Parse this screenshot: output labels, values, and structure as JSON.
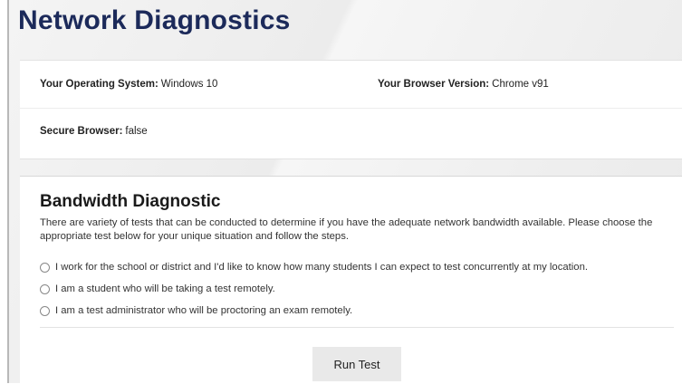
{
  "header": {
    "title": "Network Diagnostics"
  },
  "system_info": {
    "os_label": "Your Operating System:",
    "os_value": "Windows 10",
    "browser_label": "Your Browser Version:",
    "browser_value": "Chrome v91",
    "secure_label": "Secure Browser:",
    "secure_value": "false"
  },
  "bandwidth": {
    "title": "Bandwidth Diagnostic",
    "description": "There are variety of tests that can be conducted to determine if you have the adequate network bandwidth available. Please choose the appropriate test below for your unique situation and follow the steps.",
    "options": [
      {
        "label": "I work for the school or district and I'd like to know how many students I can expect to test concurrently at my location.",
        "selected": false
      },
      {
        "label": "I am a student who will be taking a test remotely.",
        "selected": false
      },
      {
        "label": "I am a test administrator who will be proctoring an exam remotely.",
        "selected": false
      }
    ],
    "run_button": "Run Test"
  },
  "colors": {
    "title": "#1c2a5a",
    "button_bg": "#e9e9e9"
  }
}
